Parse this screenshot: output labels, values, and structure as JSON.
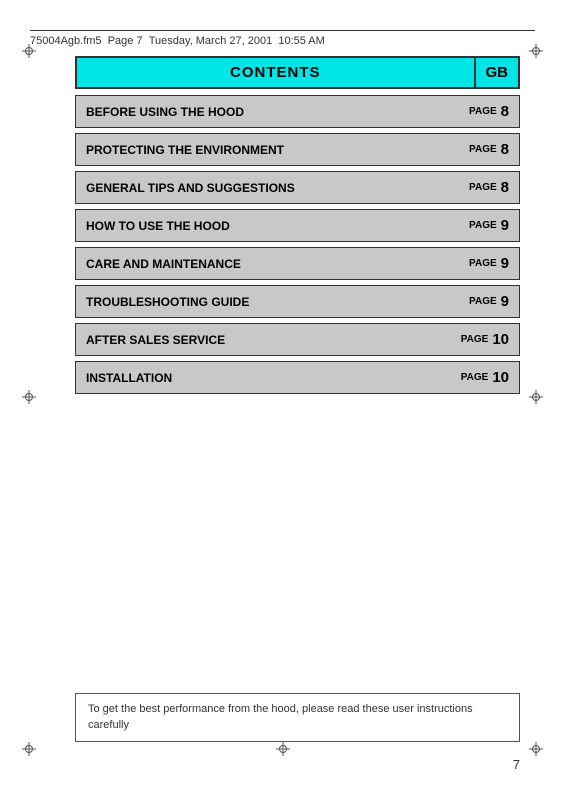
{
  "header": {
    "filename": "75004Agb.fm5",
    "page_info": "Page 7",
    "date": "Tuesday, March 27, 2001",
    "time": "10:55 AM"
  },
  "contents": {
    "title": "CONTENTS",
    "gb_label": "GB",
    "rows": [
      {
        "label": "BEFORE USING THE HOOD",
        "page_word": "PAGE",
        "page_num": "8"
      },
      {
        "label": "PROTECTING THE ENVIRONMENT",
        "page_word": "PAGE",
        "page_num": "8"
      },
      {
        "label": "GENERAL TIPS AND SUGGESTIONS",
        "page_word": "PAGE",
        "page_num": "8"
      },
      {
        "label": "HOW TO USE THE HOOD",
        "page_word": "PAGE",
        "page_num": "9"
      },
      {
        "label": "CARE AND MAINTENANCE",
        "page_word": "PAGE",
        "page_num": "9"
      },
      {
        "label": "TROUBLESHOOTING GUIDE",
        "page_word": "PAGE",
        "page_num": "9"
      },
      {
        "label": "AFTER SALES SERVICE",
        "page_word": "PAGE",
        "page_num": "10"
      },
      {
        "label": "INSTALLATION",
        "page_word": "PAGE",
        "page_num": "10"
      }
    ]
  },
  "footer": {
    "note": "To get the best performance from the hood, please read these user instructions carefully"
  },
  "page_number": "7"
}
